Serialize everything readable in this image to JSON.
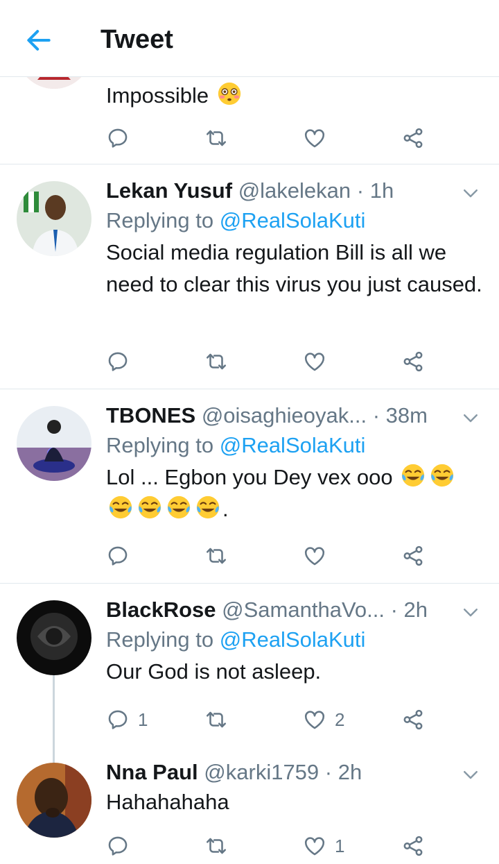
{
  "header": {
    "title": "Tweet"
  },
  "tweets": [
    {
      "text": "Impossible",
      "emoji": "flushed-face",
      "reply_count": "",
      "like_count": ""
    },
    {
      "name": "Lekan Yusuf",
      "handle": "@lakelekan",
      "time": "· 1h",
      "replying_prefix": "Replying to",
      "mention": "@RealSolaKuti",
      "text": "Social media regulation Bill is all we need to clear this virus you just caused."
    },
    {
      "name": "TBONES",
      "handle": "@oisaghieoyak...",
      "time": "· 38m",
      "replying_prefix": "Replying to",
      "mention": "@RealSolaKuti",
      "text": "Lol ... Egbon you Dey vex ooo",
      "trailing_text": ".",
      "emoji": "face-with-tears-of-joy"
    },
    {
      "name": "BlackRose",
      "handle": "@SamanthaVo...",
      "time": "· 2h",
      "replying_prefix": "Replying to",
      "mention": "@RealSolaKuti",
      "text": "Our God is not asleep.",
      "reply_count": "1",
      "like_count": "2"
    },
    {
      "name": "Nna Paul",
      "handle": "@karki1759",
      "time": "· 2h",
      "text": "Hahahahaha",
      "like_count": "1"
    }
  ],
  "colors": {
    "accent": "#1da1f2",
    "secondary_text": "#657786",
    "divider": "#e1e8ed"
  }
}
